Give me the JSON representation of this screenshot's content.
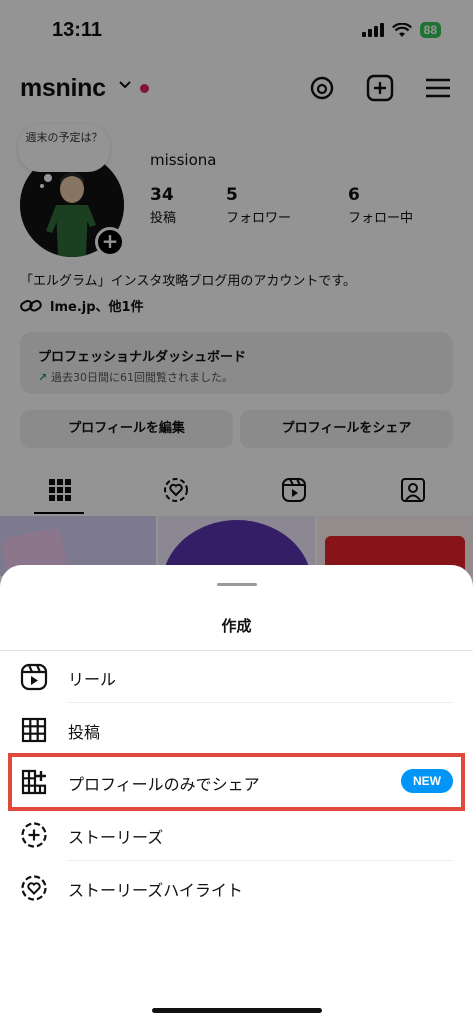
{
  "status_bar": {
    "time": "13:11",
    "battery": "88"
  },
  "header": {
    "username": "msninc"
  },
  "profile": {
    "note": "週末の予定は？",
    "display_name": "missiona",
    "stats": [
      {
        "num": "34",
        "label": "投稿"
      },
      {
        "num": "5",
        "label": "フォロワー"
      },
      {
        "num": "6",
        "label": "フォロー中"
      }
    ],
    "bio": "「エルグラム」インスタ攻略ブログ用のアカウントです。",
    "link": "lme.jp、他1件",
    "dashboard": {
      "title": "プロフェッショナルダッシュボード",
      "subtitle": "過去30日間に61回閲覧されました。"
    },
    "edit_button": "プロフィールを編集",
    "share_button": "プロフィールをシェア"
  },
  "sheet": {
    "title": "作成",
    "items": [
      {
        "label": "リール",
        "icon": "reels-icon"
      },
      {
        "label": "投稿",
        "icon": "grid-icon"
      },
      {
        "label": "プロフィールのみでシェア",
        "icon": "grid-plus-icon",
        "badge": "NEW"
      },
      {
        "label": "ストーリーズ",
        "icon": "story-add-icon"
      },
      {
        "label": "ストーリーズハイライト",
        "icon": "highlight-heart-icon"
      }
    ]
  },
  "colors": {
    "accent": "#0095f6",
    "highlight_border": "#e0493c",
    "battery": "#34c759"
  }
}
